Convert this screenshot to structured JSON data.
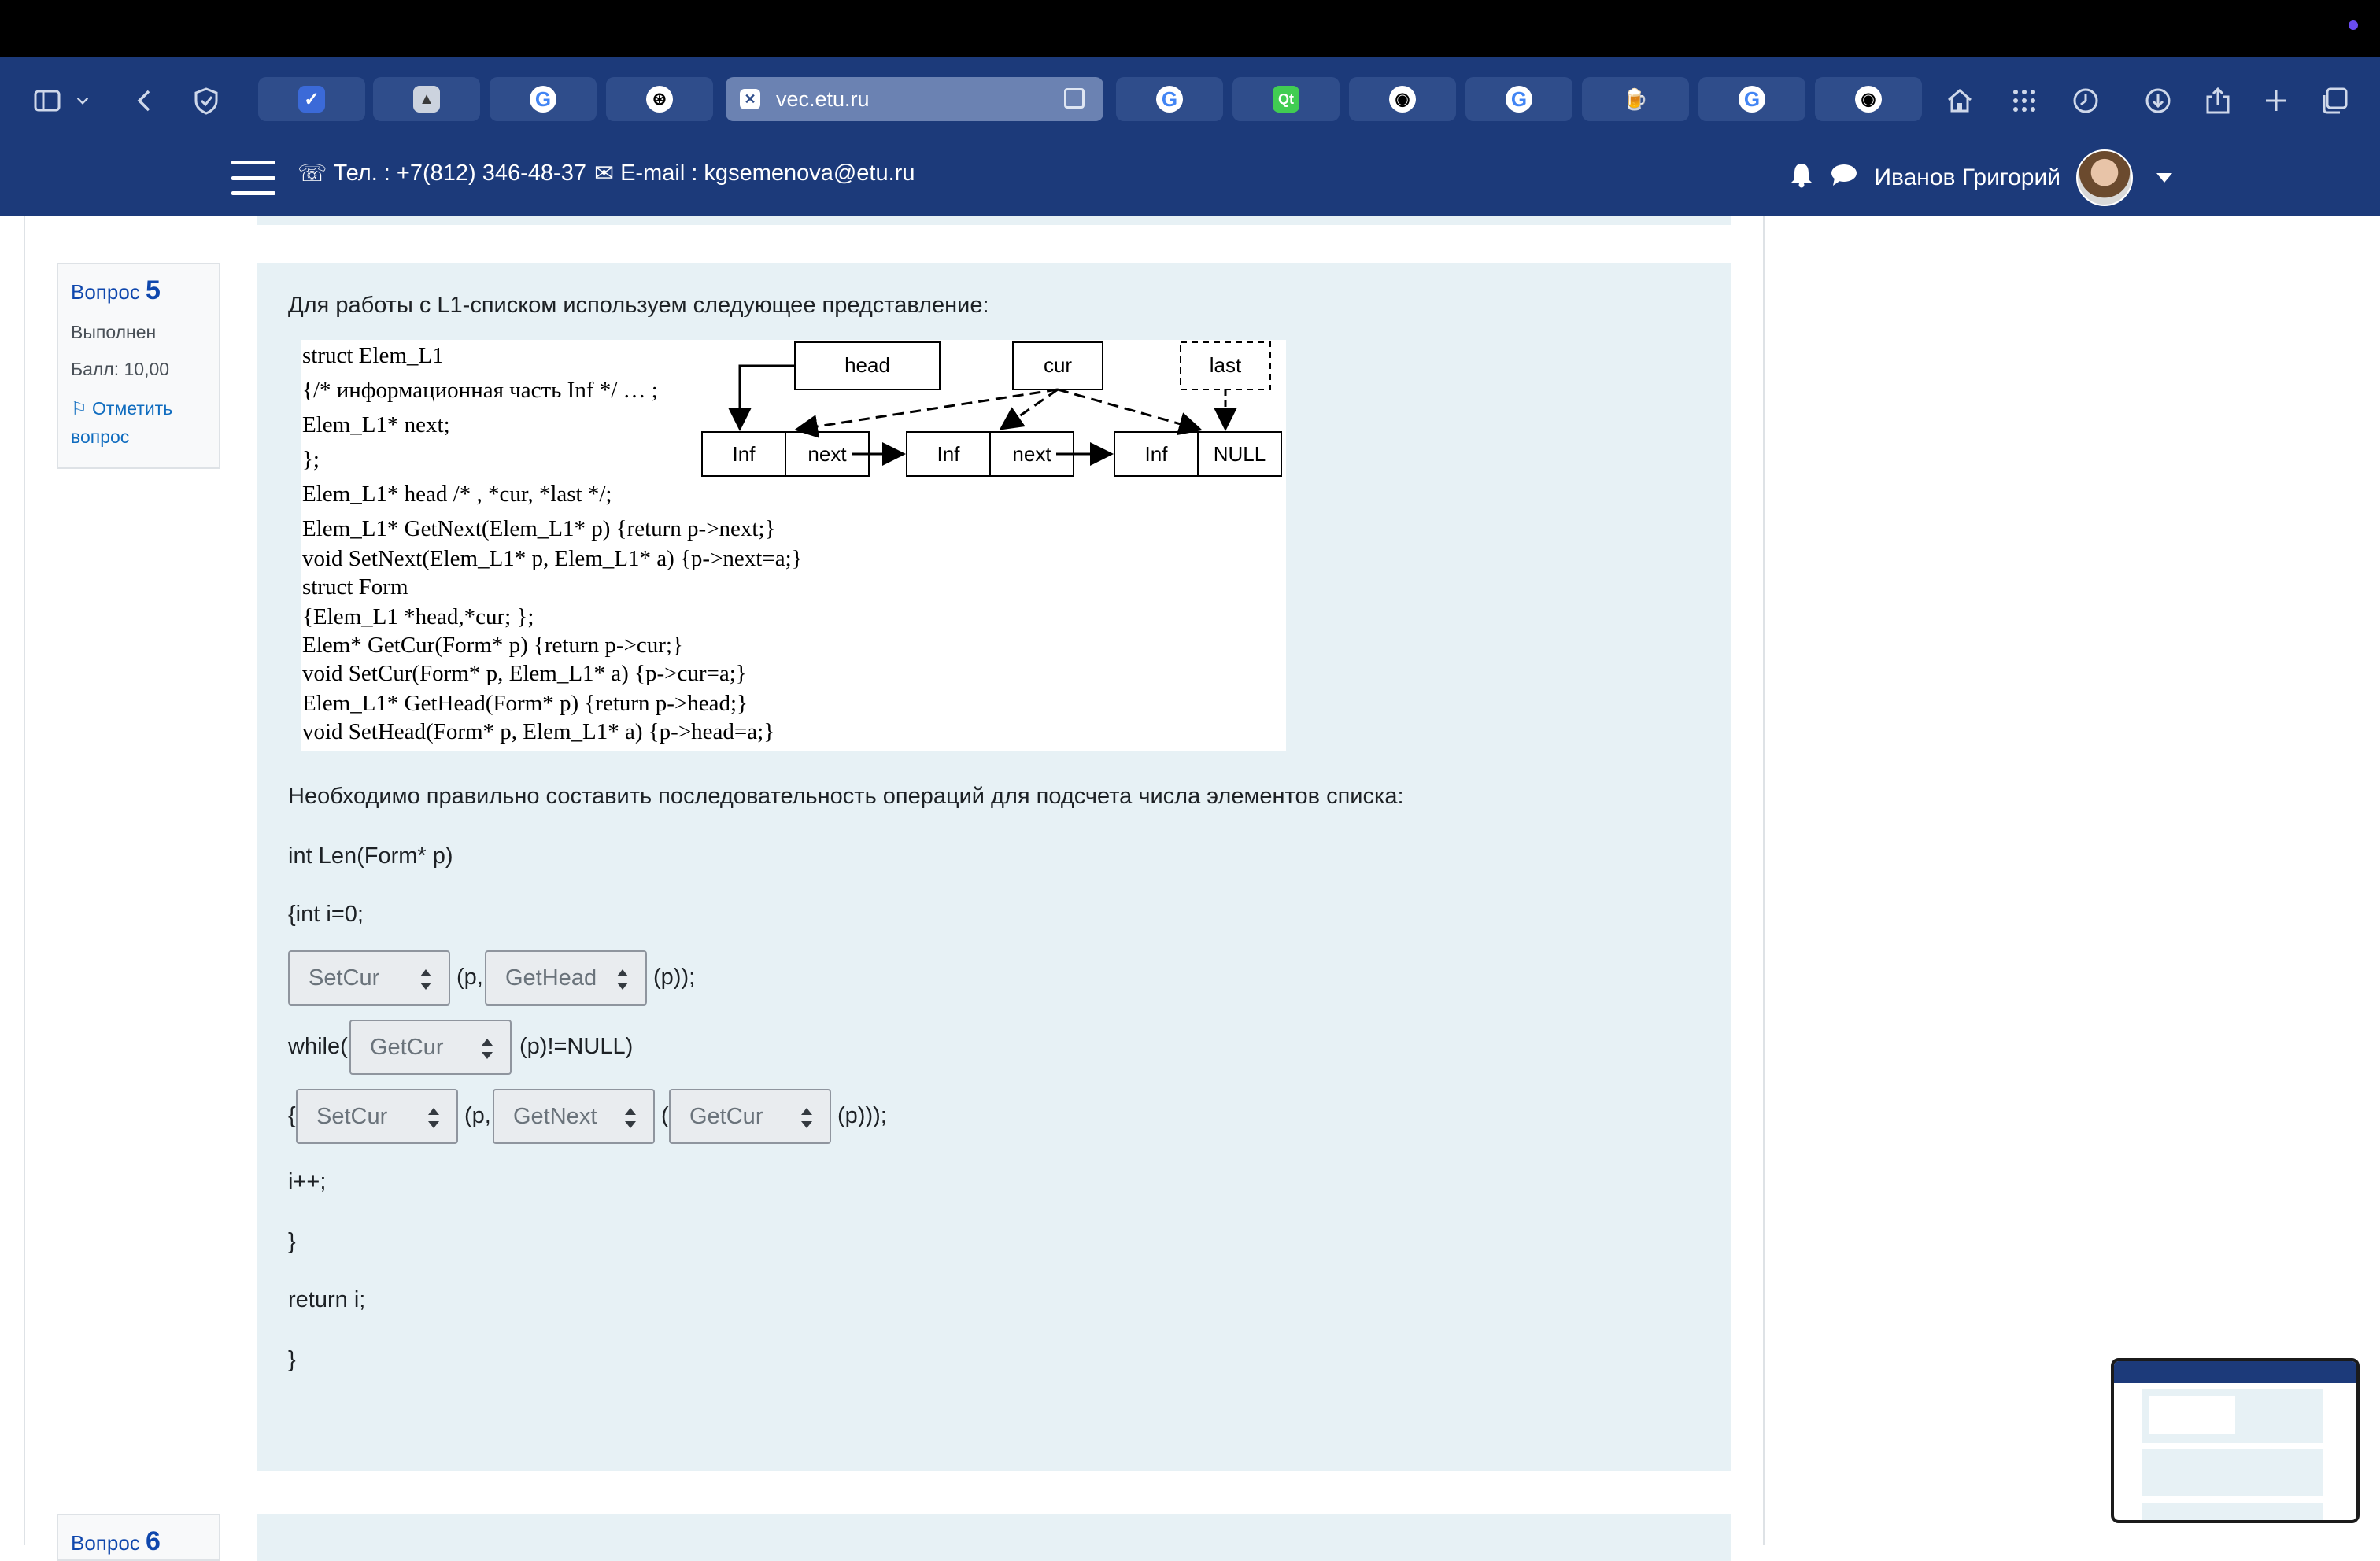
{
  "browser": {
    "active_tab_url": "vec.etu.ru",
    "tabs": [
      {
        "icon": "browser-logo-icon",
        "glyph": "✓"
      },
      {
        "icon": "apps-icon",
        "glyph": "▲"
      },
      {
        "icon": "google-icon",
        "glyph": "G"
      },
      {
        "icon": "openai-icon",
        "glyph": "⊛"
      },
      {
        "icon": "etu-favicon",
        "active": true
      },
      {
        "icon": "google-icon",
        "glyph": "G"
      },
      {
        "icon": "qt-icon",
        "glyph": "Qt"
      },
      {
        "icon": "github-icon",
        "glyph": "◉"
      },
      {
        "icon": "google-icon",
        "glyph": "G"
      },
      {
        "icon": "beer-icon",
        "glyph": "🍺"
      },
      {
        "icon": "google-icon",
        "glyph": "G"
      },
      {
        "icon": "github-icon",
        "glyph": "◉"
      }
    ]
  },
  "header": {
    "phone": "Тел. : +7(812) 346-48-37",
    "email": "E-mail : kgsemenova@etu.ru",
    "user_name": "Иванов Григорий"
  },
  "question": {
    "label": "Вопрос",
    "number": "5",
    "status": "Выполнен",
    "score": "Балл: 10,00",
    "flag_text_1": "Отметить",
    "flag_text_2": "вопрос",
    "intro": "Для работы с L1-списком используем следующее представление:",
    "task": "Необходимо правильно составить последовательность операций для подсчета числа элементов списка:",
    "code_lines": {
      "l1": "int Len(Form* p)",
      "l2": "{int i=0;",
      "l3_mid": "(p,",
      "l3_end": "(p));",
      "l4_start": "while(",
      "l4_end": "(p)!=NULL)",
      "l5_start": "{",
      "l5_mid": "(p,",
      "l5_paren": "(",
      "l5_end": "(p)));",
      "l6": "i++;",
      "l7": "}",
      "l8": "return i;",
      "l9": "}"
    },
    "selects": {
      "s1": "SetCur",
      "s2": "GetHead",
      "s3": "GetCur",
      "s4": "SetCur",
      "s5": "GetNext",
      "s6": "GetCur"
    }
  },
  "figure": {
    "code": [
      "struct Elem_L1",
      "{/* информационная часть Inf */ … ;",
      "   Elem_L1* next;",
      "};",
      "Elem_L1* head /* , *cur, *last */;",
      "Elem_L1* GetNext(Elem_L1* p) {return p->next;}",
      "void SetNext(Elem_L1* p, Elem_L1* a) {p->next=a;}",
      "struct Form",
      "   {Elem_L1 *head,*cur; };",
      "Elem* GetCur(Form* p) {return p->cur;}",
      "void SetCur(Form* p, Elem_L1* a) {p->cur=a;}",
      "Elem_L1* GetHead(Form* p) {return p->head;}",
      "void SetHead(Form* p, Elem_L1* a) {p->head=a;}"
    ],
    "diagram": {
      "head": "head",
      "cur": "cur",
      "last": "last",
      "node_inf": "Inf",
      "node_next": "next",
      "node_null": "NULL"
    }
  },
  "next_question": {
    "label": "Вопрос",
    "number": "6"
  }
}
